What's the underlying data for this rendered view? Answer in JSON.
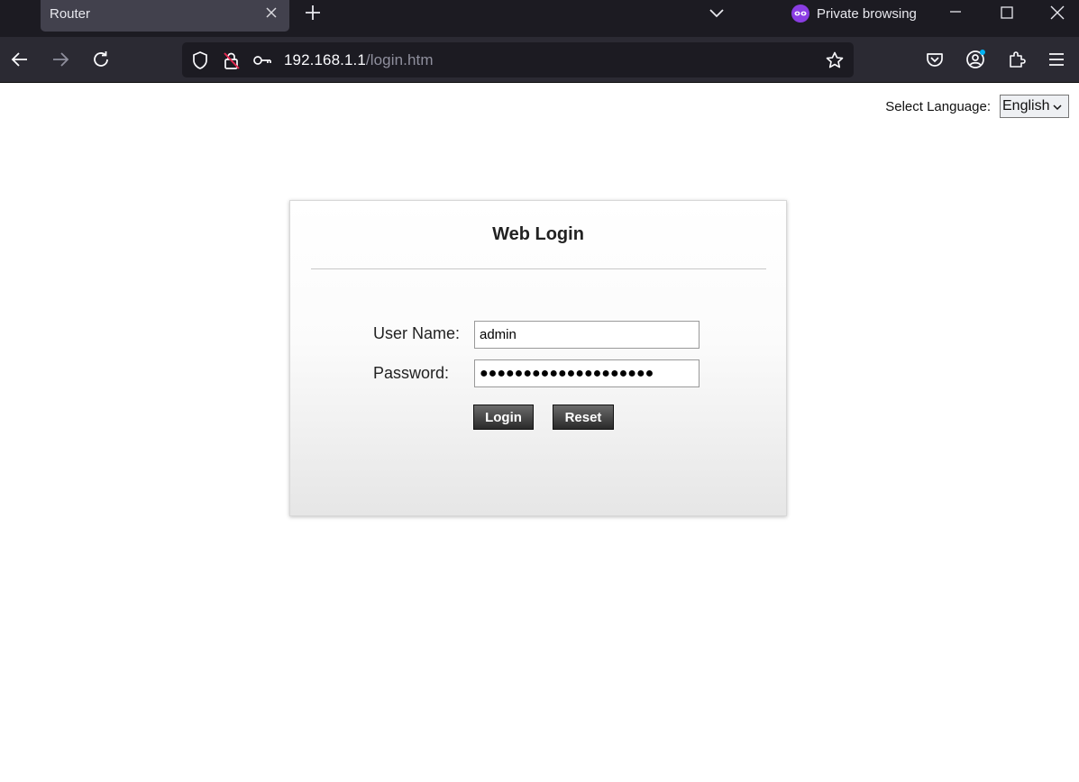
{
  "browser": {
    "tab_title": "Router",
    "private_label": "Private browsing",
    "url_host": "192.168.1.1",
    "url_path": "/login.htm"
  },
  "page": {
    "language_label": "Select Language:",
    "language_value": "English",
    "title": "Web Login",
    "username_label": "User Name:",
    "username_value": "admin",
    "password_label": "Password:",
    "password_value": "●●●●●●●●●●●●●●●●●●●●",
    "login_button": "Login",
    "reset_button": "Reset"
  },
  "colors": {
    "chrome_dark": "#1c1b22",
    "toolbar": "#2b2a33",
    "private_accent": "#8a3de3"
  }
}
